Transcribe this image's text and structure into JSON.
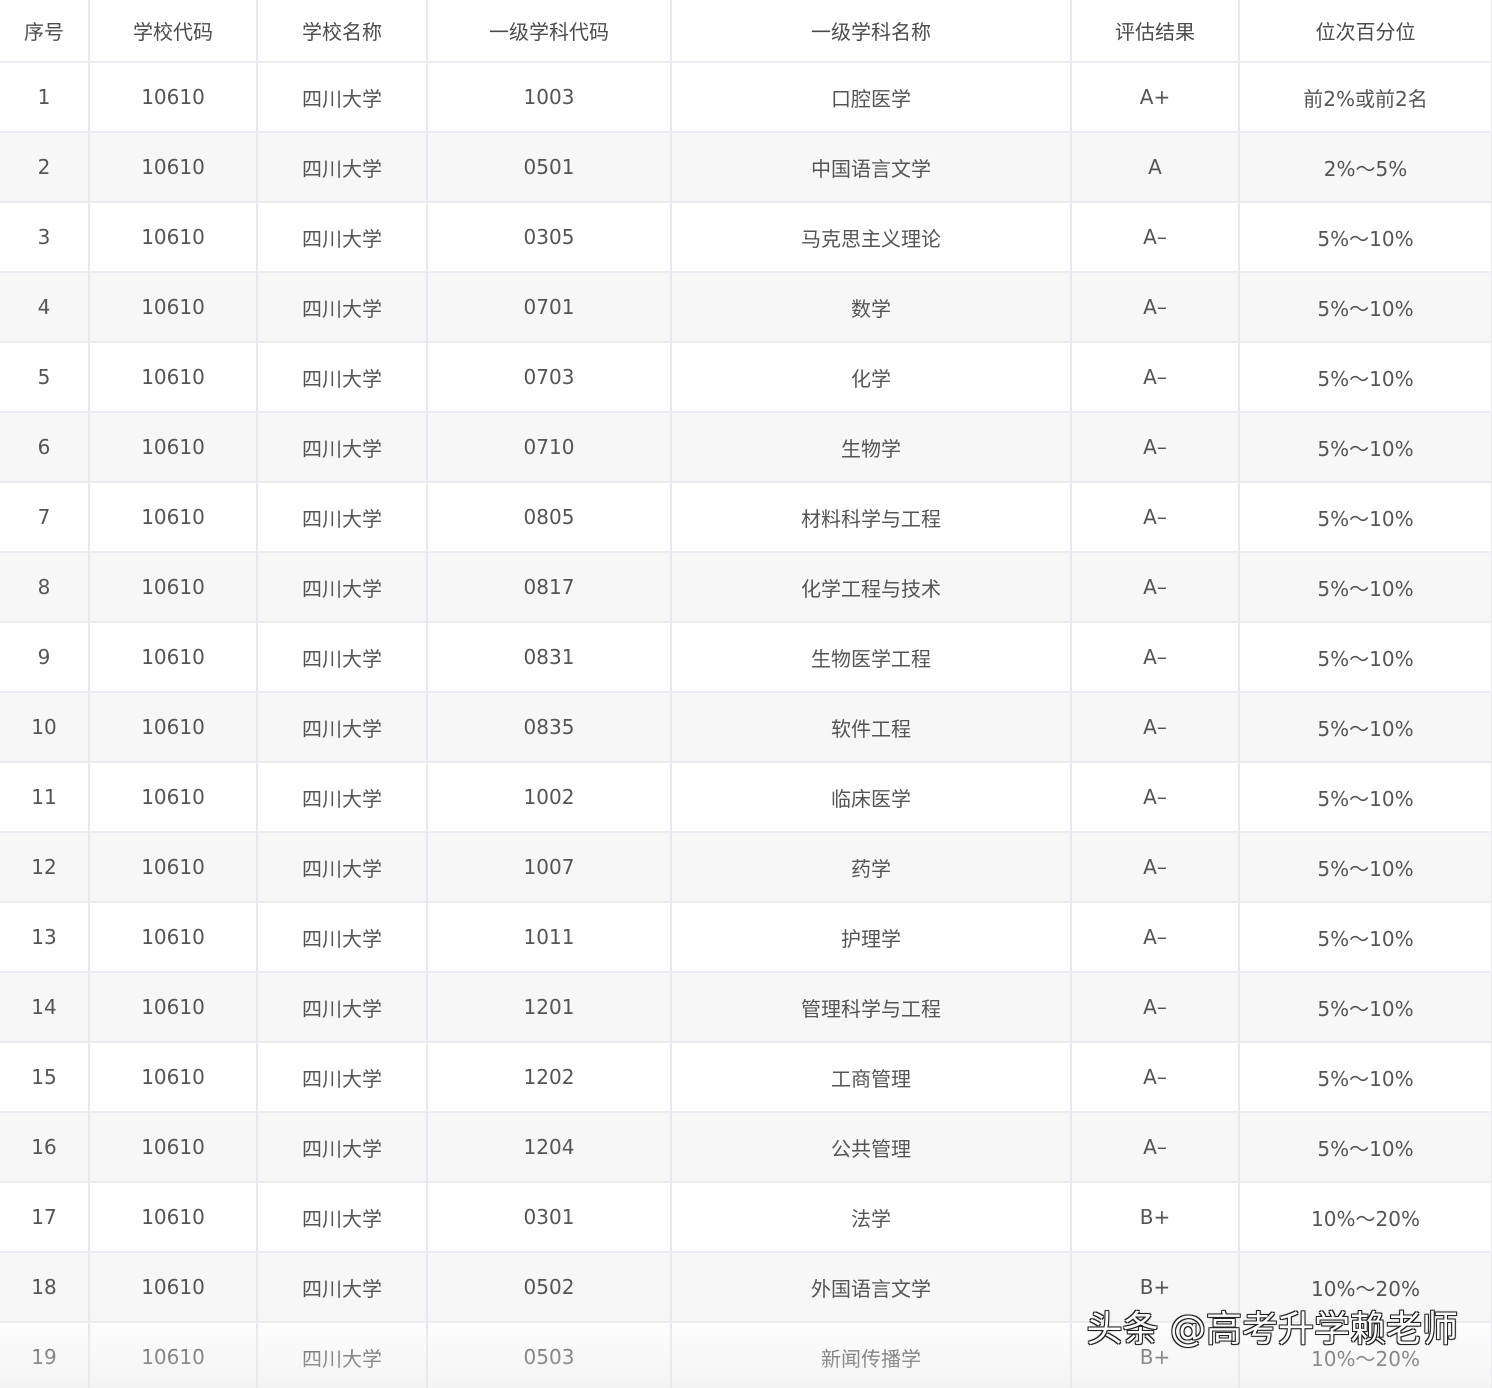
{
  "table": {
    "headers": [
      "序号",
      "学校代码",
      "学校名称",
      "一级学科代码",
      "一级学科名称",
      "评估结果",
      "位次百分位"
    ],
    "rows": [
      [
        "1",
        "10610",
        "四川大学",
        "1003",
        "口腔医学",
        "A+",
        "前2%或前2名"
      ],
      [
        "2",
        "10610",
        "四川大学",
        "0501",
        "中国语言文学",
        "A",
        "2%～5%"
      ],
      [
        "3",
        "10610",
        "四川大学",
        "0305",
        "马克思主义理论",
        "A–",
        "5%～10%"
      ],
      [
        "4",
        "10610",
        "四川大学",
        "0701",
        "数学",
        "A–",
        "5%～10%"
      ],
      [
        "5",
        "10610",
        "四川大学",
        "0703",
        "化学",
        "A–",
        "5%～10%"
      ],
      [
        "6",
        "10610",
        "四川大学",
        "0710",
        "生物学",
        "A–",
        "5%～10%"
      ],
      [
        "7",
        "10610",
        "四川大学",
        "0805",
        "材料科学与工程",
        "A–",
        "5%～10%"
      ],
      [
        "8",
        "10610",
        "四川大学",
        "0817",
        "化学工程与技术",
        "A–",
        "5%～10%"
      ],
      [
        "9",
        "10610",
        "四川大学",
        "0831",
        "生物医学工程",
        "A–",
        "5%～10%"
      ],
      [
        "10",
        "10610",
        "四川大学",
        "0835",
        "软件工程",
        "A–",
        "5%～10%"
      ],
      [
        "11",
        "10610",
        "四川大学",
        "1002",
        "临床医学",
        "A–",
        "5%～10%"
      ],
      [
        "12",
        "10610",
        "四川大学",
        "1007",
        "药学",
        "A–",
        "5%～10%"
      ],
      [
        "13",
        "10610",
        "四川大学",
        "1011",
        "护理学",
        "A–",
        "5%～10%"
      ],
      [
        "14",
        "10610",
        "四川大学",
        "1201",
        "管理科学与工程",
        "A–",
        "5%～10%"
      ],
      [
        "15",
        "10610",
        "四川大学",
        "1202",
        "工商管理",
        "A–",
        "5%～10%"
      ],
      [
        "16",
        "10610",
        "四川大学",
        "1204",
        "公共管理",
        "A–",
        "5%～10%"
      ],
      [
        "17",
        "10610",
        "四川大学",
        "0301",
        "法学",
        "B+",
        "10%～20%"
      ],
      [
        "18",
        "10610",
        "四川大学",
        "0502",
        "外国语言文学",
        "B+",
        "10%～20%"
      ],
      [
        "19",
        "10610",
        "四川大学",
        "0503",
        "新闻传播学",
        "B+",
        "10%～20%"
      ]
    ]
  },
  "watermark": "头条 @高考升学赖老师"
}
